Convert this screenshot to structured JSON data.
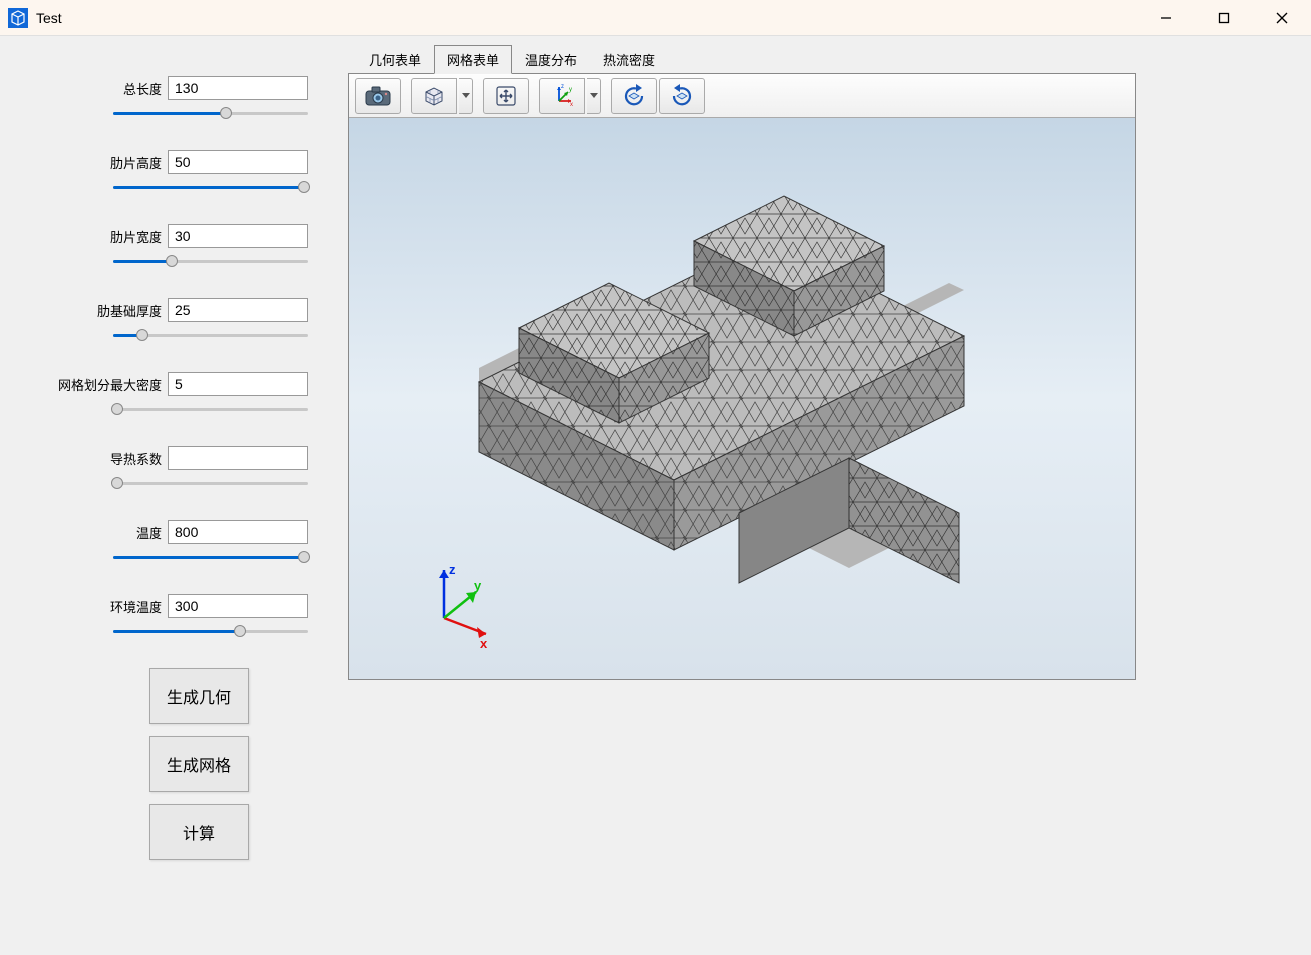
{
  "window": {
    "title": "Test"
  },
  "params": [
    {
      "label": "总长度",
      "value": "130",
      "fill": 58
    },
    {
      "label": "肋片高度",
      "value": "50",
      "fill": 98
    },
    {
      "label": "肋片宽度",
      "value": "30",
      "fill": 30
    },
    {
      "label": "肋基础厚度",
      "value": "25",
      "fill": 15
    },
    {
      "label": "网格划分最大密度",
      "value": "5",
      "fill": 2
    },
    {
      "label": "导热系数",
      "value": "",
      "fill": 2
    },
    {
      "label": "温度",
      "value": "800",
      "fill": 98
    },
    {
      "label": "环境温度",
      "value": "300",
      "fill": 65
    }
  ],
  "buttons": {
    "gen_geometry": "生成几何",
    "gen_mesh": "生成网格",
    "compute": "计算"
  },
  "tabs": [
    {
      "label": "几何表单",
      "active": false
    },
    {
      "label": "网格表单",
      "active": true
    },
    {
      "label": "温度分布",
      "active": false
    },
    {
      "label": "热流密度",
      "active": false
    }
  ],
  "toolbar": {
    "camera": "camera-icon",
    "cube": "cube-view-icon",
    "pan": "pan-icon",
    "axes": "axes-triad-icon",
    "rotate_ccw": "rotate-ccw-icon",
    "rotate_cw": "rotate-cw-icon"
  },
  "axes": {
    "x": "x",
    "y": "y",
    "z": "z"
  }
}
